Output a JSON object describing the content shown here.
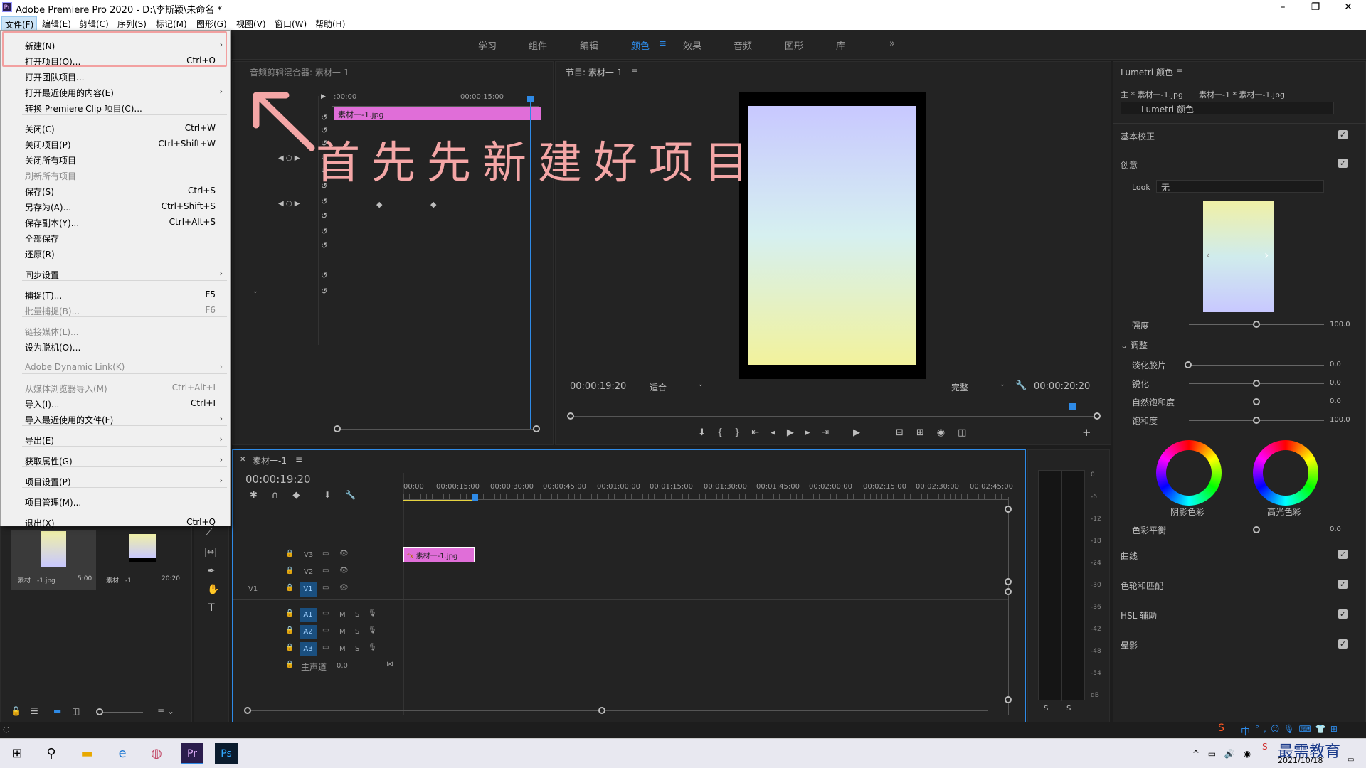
{
  "app": {
    "title": "Adobe Premiere Pro 2020 - D:\\李斯颖\\未命名 *",
    "icon_label": "Pr"
  },
  "menubar": [
    "文件(F)",
    "编辑(E)",
    "剪辑(C)",
    "序列(S)",
    "标记(M)",
    "图形(G)",
    "视图(V)",
    "窗口(W)",
    "帮助(H)"
  ],
  "workspaces": [
    "学习",
    "组件",
    "编辑",
    "颜色",
    "效果",
    "音频",
    "图形",
    "库"
  ],
  "active_workspace": "颜色",
  "file_menu": [
    {
      "label": "新建(N)",
      "shortcut": "",
      "arrow": true,
      "disabled": false
    },
    {
      "label": "打开项目(O)...",
      "shortcut": "Ctrl+O",
      "arrow": false,
      "disabled": false
    },
    {
      "label": "打开团队项目...",
      "shortcut": "",
      "arrow": false,
      "disabled": false
    },
    {
      "label": "打开最近使用的内容(E)",
      "shortcut": "",
      "arrow": true,
      "disabled": false
    },
    {
      "label": "转换 Premiere Clip 项目(C)...",
      "shortcut": "",
      "arrow": false,
      "disabled": false
    },
    {
      "label": "关闭(C)",
      "shortcut": "Ctrl+W",
      "arrow": false,
      "disabled": false
    },
    {
      "label": "关闭项目(P)",
      "shortcut": "Ctrl+Shift+W",
      "arrow": false,
      "disabled": false
    },
    {
      "label": "关闭所有项目",
      "shortcut": "",
      "arrow": false,
      "disabled": false
    },
    {
      "label": "刷新所有项目",
      "shortcut": "",
      "arrow": false,
      "disabled": true
    },
    {
      "label": "保存(S)",
      "shortcut": "Ctrl+S",
      "arrow": false,
      "disabled": false
    },
    {
      "label": "另存为(A)...",
      "shortcut": "Ctrl+Shift+S",
      "arrow": false,
      "disabled": false
    },
    {
      "label": "保存副本(Y)...",
      "shortcut": "Ctrl+Alt+S",
      "arrow": false,
      "disabled": false
    },
    {
      "label": "全部保存",
      "shortcut": "",
      "arrow": false,
      "disabled": false
    },
    {
      "label": "还原(R)",
      "shortcut": "",
      "arrow": false,
      "disabled": false
    },
    {
      "label": "同步设置",
      "shortcut": "",
      "arrow": true,
      "disabled": false
    },
    {
      "label": "捕捉(T)...",
      "shortcut": "F5",
      "arrow": false,
      "disabled": false
    },
    {
      "label": "批量捕捉(B)...",
      "shortcut": "F6",
      "arrow": false,
      "disabled": true
    },
    {
      "label": "链接媒体(L)...",
      "shortcut": "",
      "arrow": false,
      "disabled": true
    },
    {
      "label": "设为脱机(O)...",
      "shortcut": "",
      "arrow": false,
      "disabled": false
    },
    {
      "label": "Adobe Dynamic Link(K)",
      "shortcut": "",
      "arrow": true,
      "disabled": true
    },
    {
      "label": "从媒体浏览器导入(M)",
      "shortcut": "Ctrl+Alt+I",
      "arrow": false,
      "disabled": true
    },
    {
      "label": "导入(I)...",
      "shortcut": "Ctrl+I",
      "arrow": false,
      "disabled": false
    },
    {
      "label": "导入最近使用的文件(F)",
      "shortcut": "",
      "arrow": true,
      "disabled": false
    },
    {
      "label": "导出(E)",
      "shortcut": "",
      "arrow": true,
      "disabled": false
    },
    {
      "label": "获取属性(G)",
      "shortcut": "",
      "arrow": true,
      "disabled": false
    },
    {
      "label": "项目设置(P)",
      "shortcut": "",
      "arrow": true,
      "disabled": false
    },
    {
      "label": "项目管理(M)...",
      "shortcut": "",
      "arrow": false,
      "disabled": false
    },
    {
      "label": "退出(X)",
      "shortcut": "Ctrl+Q",
      "arrow": false,
      "disabled": false
    }
  ],
  "annotation": "首先先新建好项目",
  "source_panel": {
    "title": "音频剪辑混合器: 素材一-1",
    "time_start": ":00:00",
    "time_mid": "00:00:15:00",
    "clip_label": "素材一-1.jpg"
  },
  "program": {
    "title": "节目: 素材一-1",
    "timecode": "00:00:19:20",
    "fit": "适合",
    "quality": "完整",
    "duration": "00:00:20:20"
  },
  "lumetri": {
    "title": "Lumetri 颜色",
    "source": "主 * 素材一-1.jpg",
    "target": "素材一-1 * 素材一-1.jpg",
    "fx_name": "Lumetri 颜色",
    "basic": "基本校正",
    "creative": "创意",
    "look_label": "Look",
    "look_value": "无",
    "intensity_label": "强度",
    "intensity_value": "100.0",
    "adjust": "调整",
    "sliders": [
      {
        "label": "淡化胶片",
        "value": "0.0"
      },
      {
        "label": "锐化",
        "value": "0.0"
      },
      {
        "label": "自然饱和度",
        "value": "0.0"
      },
      {
        "label": "饱和度",
        "value": "100.0"
      }
    ],
    "wheel_shadow": "阴影色彩",
    "wheel_highlight": "高光色彩",
    "balance_label": "色彩平衡",
    "balance_value": "0.0",
    "sections": [
      "曲线",
      "色轮和匹配",
      "HSL 辅助",
      "晕影"
    ]
  },
  "timeline": {
    "title": "素材一-1",
    "timecode": "00:00:19:20",
    "ruler": [
      "00:00",
      "00:00:15:00",
      "00:00:30:00",
      "00:00:45:00",
      "00:01:00:00",
      "00:01:15:00",
      "00:01:30:00",
      "00:01:45:00",
      "00:02:00:00",
      "00:02:15:00",
      "00:02:30:00",
      "00:02:45:00"
    ],
    "video_tracks": [
      "V3",
      "V2",
      "V1"
    ],
    "audio_tracks": [
      "A1",
      "A2",
      "A3"
    ],
    "source_track": "V1",
    "master_label": "主声道",
    "master_value": "0.0",
    "clip_label": "素材一-1.jpg",
    "mute": "M",
    "solo": "S"
  },
  "meter_ticks": [
    "0",
    "-6",
    "-12",
    "-18",
    "-24",
    "-30",
    "-36",
    "-42",
    "-48",
    "-54",
    "dB"
  ],
  "meter_solo": [
    "S",
    "S"
  ],
  "project": {
    "items": [
      {
        "name": "素材一-1.jpg",
        "duration": "5:00"
      },
      {
        "name": "素材一-1",
        "duration": "20:20"
      }
    ]
  },
  "taskbar": {
    "date": "2021/10/18",
    "brand": "最需教育",
    "ime": "中"
  }
}
